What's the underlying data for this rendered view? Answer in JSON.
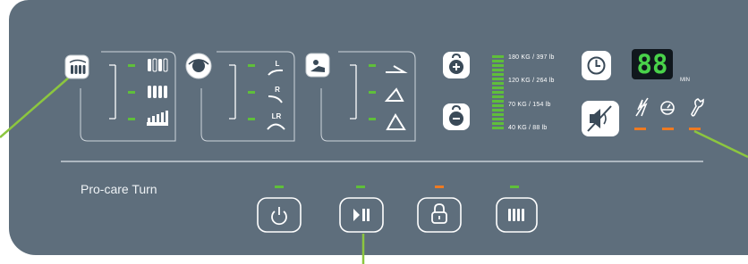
{
  "panel": {
    "label": "Pro-care Turn",
    "accent_green": "#5fbf3a",
    "accent_orange": "#ee7a22",
    "panel_color": "#5e6e7c"
  },
  "groups": [
    {
      "icon": "mattress-roll-icon",
      "rows": [
        {
          "icon": "cells-a-icon",
          "led": "green"
        },
        {
          "icon": "cells-b-icon",
          "led": "green"
        },
        {
          "icon": "cells-c-icon",
          "led": "green"
        }
      ]
    },
    {
      "icon": "turn-head-icon",
      "rows": [
        {
          "label": "L",
          "led": "green"
        },
        {
          "label": "R",
          "led": "green"
        },
        {
          "label": "LR",
          "led": "green"
        }
      ]
    },
    {
      "icon": "head-section-icon",
      "rows": [
        {
          "icon": "angle-low-icon",
          "led": "green"
        },
        {
          "icon": "angle-mid-icon",
          "led": "green"
        },
        {
          "icon": "angle-high-icon",
          "led": "green"
        }
      ]
    }
  ],
  "weight": {
    "labels": [
      "180 KG / 397 lb",
      "120 KG / 264 lb",
      "70 KG / 154 lb",
      "40 KG / 88 lb"
    ]
  },
  "timer": {
    "value": "88",
    "unit": "MIN"
  },
  "status": [
    {
      "icon": "power-fail-icon",
      "led": "orange"
    },
    {
      "icon": "pressure-gauge-icon",
      "led": "orange"
    },
    {
      "icon": "service-wrench-icon",
      "led": "orange"
    }
  ],
  "bottom_buttons": [
    {
      "icon": "power-icon",
      "led": "green"
    },
    {
      "icon": "play-pause-icon",
      "led": "green"
    },
    {
      "icon": "lock-icon",
      "led": "orange"
    },
    {
      "icon": "static-mattress-icon",
      "led": "green"
    }
  ]
}
